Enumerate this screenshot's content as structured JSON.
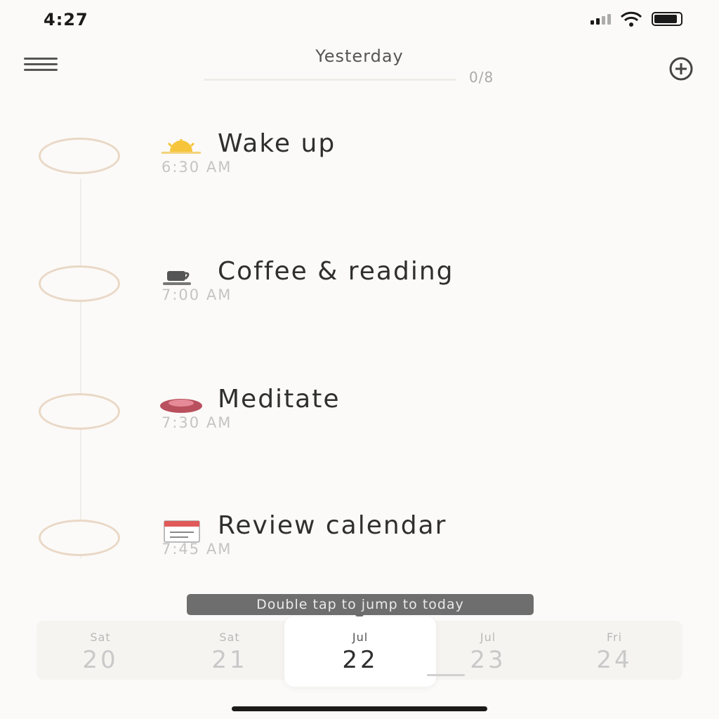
{
  "status_bar": {
    "time": "4:27"
  },
  "header": {
    "title": "Yesterday",
    "progress_text": "0/8",
    "progress_fraction": 0
  },
  "habits": [
    {
      "name": "Wake up",
      "time": "6:30 AM",
      "icon": "sunrise-icon"
    },
    {
      "name": "Coffee & reading",
      "time": "7:00 AM",
      "icon": "coffee-icon"
    },
    {
      "name": "Meditate",
      "time": "7:30 AM",
      "icon": "meditate-icon"
    },
    {
      "name": "Review calendar",
      "time": "7:45 AM",
      "icon": "calendar-icon"
    }
  ],
  "tooltip": {
    "text": "Double tap to jump to today"
  },
  "day_strip": [
    {
      "weekday": "Sat",
      "day": "20"
    },
    {
      "weekday": "Sat",
      "day": "21"
    },
    {
      "weekday": "Jul",
      "day": "22"
    },
    {
      "weekday": "Jul",
      "day": "23"
    },
    {
      "weekday": "Fri",
      "day": "24"
    }
  ],
  "colors": {
    "background": "#fbfaf8",
    "circle_border": "#ead8c6",
    "tooltip_bg": "#6e6e6e"
  }
}
